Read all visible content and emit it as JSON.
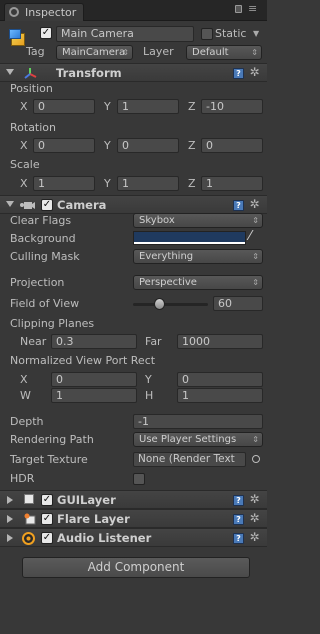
{
  "tab": {
    "title": "Inspector"
  },
  "object": {
    "name": "Main Camera",
    "active": true,
    "static_label": "Static",
    "tag_label": "Tag",
    "tag_value": "MainCamera",
    "layer_label": "Layer",
    "layer_value": "Default"
  },
  "transform": {
    "title": "Transform",
    "position_label": "Position",
    "rotation_label": "Rotation",
    "scale_label": "Scale",
    "position": {
      "x": "0",
      "y": "1",
      "z": "-10"
    },
    "rotation": {
      "x": "0",
      "y": "0",
      "z": "0"
    },
    "scale": {
      "x": "1",
      "y": "1",
      "z": "1"
    },
    "axis": {
      "x": "X",
      "y": "Y",
      "z": "Z"
    }
  },
  "camera": {
    "title": "Camera",
    "clear_flags_label": "Clear Flags",
    "clear_flags": "Skybox",
    "background_label": "Background",
    "background_color": "#1f3a5f",
    "culling_mask_label": "Culling Mask",
    "culling_mask": "Everything",
    "projection_label": "Projection",
    "projection": "Perspective",
    "fov_label": "Field of View",
    "fov": "60",
    "fov_fraction": 0.33,
    "clipping_label": "Clipping Planes",
    "near_label": "Near",
    "near": "0.3",
    "far_label": "Far",
    "far": "1000",
    "viewport_label": "Normalized View Port Rect",
    "vp": {
      "x_label": "X",
      "x": "0",
      "y_label": "Y",
      "y": "0",
      "w_label": "W",
      "w": "1",
      "h_label": "H",
      "h": "1"
    },
    "depth_label": "Depth",
    "depth": "-1",
    "rendering_path_label": "Rendering Path",
    "rendering_path": "Use Player Settings",
    "target_texture_label": "Target Texture",
    "target_texture": "None (Render Text",
    "hdr_label": "HDR"
  },
  "components": {
    "guilayer": "GUILayer",
    "flare": "Flare Layer",
    "audio": "Audio Listener"
  },
  "add_component": "Add Component",
  "colors": {
    "panel_bg": "#383838",
    "header_bg": "#3e3e3e",
    "field_bg": "#494949",
    "accent": "#4a7ab8"
  }
}
